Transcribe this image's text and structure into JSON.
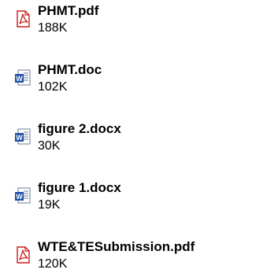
{
  "files": [
    {
      "name": "PHMT.pdf",
      "size": "188K",
      "icon": "pdf-icon"
    },
    {
      "name": "PHMT.doc",
      "size": "102K",
      "icon": "word-doc-icon"
    },
    {
      "name": "figure 2.docx",
      "size": "30K",
      "icon": "word-doc-icon"
    },
    {
      "name": "figure 1.docx",
      "size": "19K",
      "icon": "word-doc-icon"
    },
    {
      "name": "WTE&TESubmission.pdf",
      "size": "120K",
      "icon": "pdf-icon"
    }
  ],
  "colors": {
    "pdf": "#cc1b1b",
    "word": "#1d4fa8"
  }
}
